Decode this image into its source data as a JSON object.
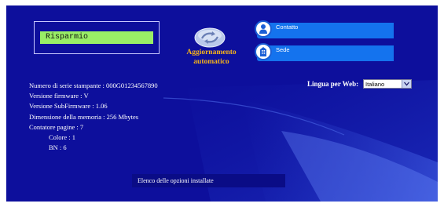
{
  "status": {
    "lcd_text": "Risparmio"
  },
  "auto_refresh": {
    "label_line1": "Aggiornamento",
    "label_line2": "automatico"
  },
  "links": {
    "contact_label": "Contatto",
    "location_label": "Sede"
  },
  "info": {
    "serial": "Numero di serie stampante : 000G01234567890",
    "firmware": "Versione firmware : V",
    "subfirmware": "Versione SubFirmware : 1.06",
    "memory": "Dimensione della memoria : 256 Mbytes",
    "page_counter": "Contatore pagine : 7",
    "color": "Colore : 1",
    "bw": "BN : 6"
  },
  "language": {
    "label": "Lingua per Web:",
    "selected": "Italiano"
  },
  "options": {
    "link_text": "Elenco delle opzioni installate"
  },
  "colors": {
    "background": "#0d0f9c",
    "link_button": "#1473ee",
    "lcd": "#99ee66",
    "refresh_label": "#f5b21a"
  },
  "icons": [
    "refresh-icon",
    "contact-icon",
    "location-icon",
    "chevron-down-icon"
  ]
}
